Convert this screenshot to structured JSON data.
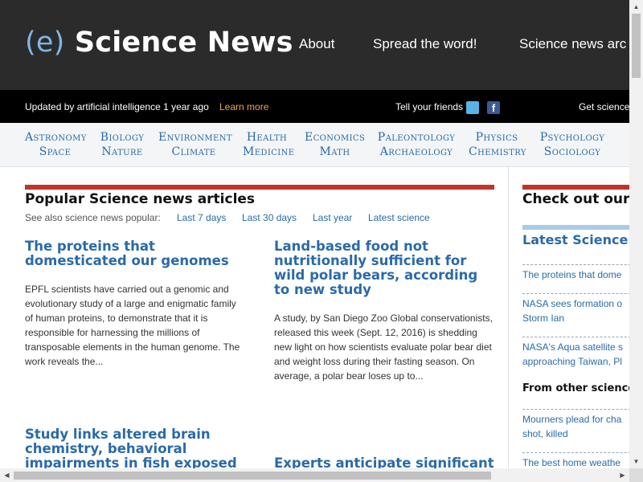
{
  "header": {
    "logo_paren": "(e)",
    "logo_text": "Science News",
    "nav": [
      "About",
      "Spread the word!",
      "Science news arc"
    ]
  },
  "strip": {
    "updated": "Updated by artificial intelligence 1 year ago",
    "learn_more": "Learn more",
    "tell_friends": "Tell your friends",
    "facebook_letter": "f",
    "get_science": "Get science"
  },
  "categories": [
    {
      "top": "Astronomy",
      "bottom": "Space"
    },
    {
      "top": "Biology",
      "bottom": "Nature"
    },
    {
      "top": "Environment",
      "bottom": "Climate"
    },
    {
      "top": "Health",
      "bottom": "Medicine"
    },
    {
      "top": "Economics",
      "bottom": "Math"
    },
    {
      "top": "Paleontology",
      "bottom": "Archaeology"
    },
    {
      "top": "Physics",
      "bottom": "Chemistry"
    },
    {
      "top": "Psychology",
      "bottom": "Sociology"
    }
  ],
  "main": {
    "title": "Popular Science news articles",
    "see_also_label": "See also science news popular:",
    "see_also_links": [
      "Last 7 days",
      "Last 30 days",
      "Last year",
      "Latest science"
    ],
    "articles": [
      {
        "title": "The proteins that domesticated our genomes",
        "excerpt": "EPFL scientists have carried out a genomic and evolutionary study of a large and enigmatic family of human proteins, to demonstrate that it is responsible for harnessing the millions of transposable elements in the human genome. The work reveals the..."
      },
      {
        "title": "Land-based food not nutritionally sufficient for wild polar bears, according to new study",
        "excerpt": "A study, by San Diego Zoo Global conservationists, released this week (Sept. 12, 2016) is shedding new light on how scientists evaluate polar bear diet and weight loss during their fasting season. On average, a polar bear loses up to..."
      },
      {
        "title": "Study links altered brain chemistry, behavioral impairments in fish exposed to",
        "excerpt": ""
      },
      {
        "title": "Experts anticipate significant",
        "excerpt": ""
      }
    ]
  },
  "sidebar": {
    "title": "Check out our ne",
    "latest_heading": "Latest Science N",
    "latest_links": [
      "The proteins that dome",
      "NASA sees formation o Storm Ian",
      "NASA's Aqua satellite s approaching Taiwan, Pl"
    ],
    "other_heading": "From other science",
    "other_links": [
      "Mourners plead for cha shot, killed",
      "The best home weathe"
    ]
  },
  "colors": {
    "accent_blue": "#2a6aa8",
    "header_bg": "#2b2b2b",
    "red_bar": "#c0352b",
    "learn_more": "#f0a34a"
  }
}
